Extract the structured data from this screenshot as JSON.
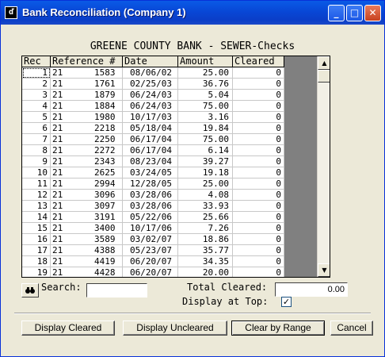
{
  "window": {
    "title": "Bank Reconciliation (Company 1)",
    "icon_text": "ď"
  },
  "heading": "GREENE COUNTY BANK - SEWER-Checks",
  "columns": [
    "Rec",
    "Reference #",
    "Date",
    "Amount",
    "Cleared"
  ],
  "rows": [
    {
      "rec": "1",
      "ref": "21      1583",
      "date": "08/06/02",
      "amount": "25.00",
      "cleared": "0"
    },
    {
      "rec": "2",
      "ref": "21      1761",
      "date": "02/25/03",
      "amount": "36.76",
      "cleared": "0"
    },
    {
      "rec": "3",
      "ref": "21      1879",
      "date": "06/24/03",
      "amount": "5.04",
      "cleared": "0"
    },
    {
      "rec": "4",
      "ref": "21      1884",
      "date": "06/24/03",
      "amount": "75.00",
      "cleared": "0"
    },
    {
      "rec": "5",
      "ref": "21      1980",
      "date": "10/17/03",
      "amount": "3.16",
      "cleared": "0"
    },
    {
      "rec": "6",
      "ref": "21      2218",
      "date": "05/18/04",
      "amount": "19.84",
      "cleared": "0"
    },
    {
      "rec": "7",
      "ref": "21      2250",
      "date": "06/17/04",
      "amount": "75.00",
      "cleared": "0"
    },
    {
      "rec": "8",
      "ref": "21      2272",
      "date": "06/17/04",
      "amount": "6.14",
      "cleared": "0"
    },
    {
      "rec": "9",
      "ref": "21      2343",
      "date": "08/23/04",
      "amount": "39.27",
      "cleared": "0"
    },
    {
      "rec": "10",
      "ref": "21      2625",
      "date": "03/24/05",
      "amount": "19.18",
      "cleared": "0"
    },
    {
      "rec": "11",
      "ref": "21      2994",
      "date": "12/28/05",
      "amount": "25.00",
      "cleared": "0"
    },
    {
      "rec": "12",
      "ref": "21      3096",
      "date": "03/28/06",
      "amount": "4.08",
      "cleared": "0"
    },
    {
      "rec": "13",
      "ref": "21      3097",
      "date": "03/28/06",
      "amount": "33.93",
      "cleared": "0"
    },
    {
      "rec": "14",
      "ref": "21      3191",
      "date": "05/22/06",
      "amount": "25.66",
      "cleared": "0"
    },
    {
      "rec": "15",
      "ref": "21      3400",
      "date": "10/17/06",
      "amount": "7.26",
      "cleared": "0"
    },
    {
      "rec": "16",
      "ref": "21      3589",
      "date": "03/02/07",
      "amount": "18.86",
      "cleared": "0"
    },
    {
      "rec": "17",
      "ref": "21      4388",
      "date": "05/23/07",
      "amount": "35.77",
      "cleared": "0"
    },
    {
      "rec": "18",
      "ref": "21      4419",
      "date": "06/20/07",
      "amount": "34.35",
      "cleared": "0"
    },
    {
      "rec": "19",
      "ref": "21      4428",
      "date": "06/20/07",
      "amount": "20.00",
      "cleared": "0"
    }
  ],
  "search": {
    "label": "Search:",
    "value": "",
    "icon": "binoculars-icon"
  },
  "total_cleared": {
    "label": "Total Cleared:",
    "value": "0.00"
  },
  "display_at_top": {
    "label": "Display at Top:",
    "checked": true,
    "mark": "✓"
  },
  "buttons": {
    "display_cleared": "Display Cleared",
    "display_uncleared": "Display Uncleared",
    "clear_by_range": "Clear by Range",
    "cancel": "Cancel"
  },
  "title_buttons": {
    "minimize": "_",
    "maximize": "□",
    "close": "✕"
  },
  "scroll_glyphs": {
    "up": "▲",
    "down": "▼"
  }
}
